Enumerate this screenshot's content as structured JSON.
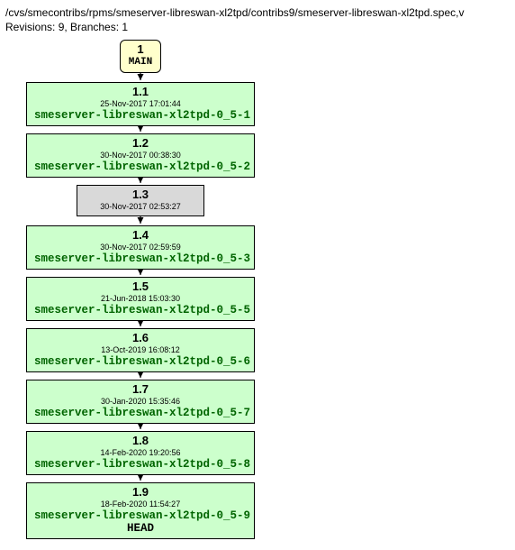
{
  "header": {
    "path": "/cvs/smecontribs/rpms/smeserver-libreswan-xl2tpd/contribs9/smeserver-libreswan-xl2tpd.spec,v",
    "summary": "Revisions: 9, Branches: 1"
  },
  "root": {
    "number": "1",
    "label": "MAIN"
  },
  "revisions": [
    {
      "ver": "1.1",
      "date": "25-Nov-2017 17:01:44",
      "tag": "smeserver-libreswan-xl2tpd-0_5-1",
      "color": "green"
    },
    {
      "ver": "1.2",
      "date": "30-Nov-2017 00:38:30",
      "tag": "smeserver-libreswan-xl2tpd-0_5-2",
      "color": "green"
    },
    {
      "ver": "1.3",
      "date": "30-Nov-2017 02:53:27",
      "tag": "",
      "color": "grey"
    },
    {
      "ver": "1.4",
      "date": "30-Nov-2017 02:59:59",
      "tag": "smeserver-libreswan-xl2tpd-0_5-3",
      "color": "green"
    },
    {
      "ver": "1.5",
      "date": "21-Jun-2018 15:03:30",
      "tag": "smeserver-libreswan-xl2tpd-0_5-5",
      "color": "green"
    },
    {
      "ver": "1.6",
      "date": "13-Oct-2019 16:08:12",
      "tag": "smeserver-libreswan-xl2tpd-0_5-6",
      "color": "green"
    },
    {
      "ver": "1.7",
      "date": "30-Jan-2020 15:35:46",
      "tag": "smeserver-libreswan-xl2tpd-0_5-7",
      "color": "green"
    },
    {
      "ver": "1.8",
      "date": "14-Feb-2020 19:20:56",
      "tag": "smeserver-libreswan-xl2tpd-0_5-8",
      "color": "green"
    },
    {
      "ver": "1.9",
      "date": "18-Feb-2020 11:54:27",
      "tag": "smeserver-libreswan-xl2tpd-0_5-9",
      "color": "green",
      "head": "HEAD"
    }
  ]
}
